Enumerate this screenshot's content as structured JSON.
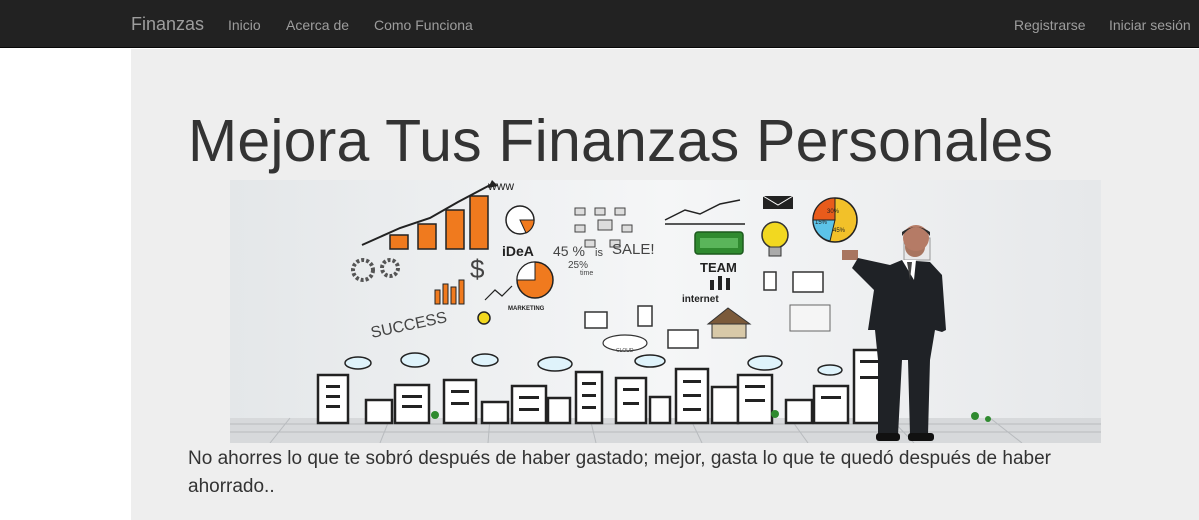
{
  "navbar": {
    "brand": "Finanzas",
    "links": [
      "Inicio",
      "Acerca de",
      "Como Funciona"
    ],
    "right_links": [
      "Registrarse",
      "Iniciar sesión"
    ],
    "background": "#222222",
    "link_color": "#9d9d9d"
  },
  "hero": {
    "title": "Mejora Tus Finanzas Personales",
    "tagline": "No ahorres lo que te sobró después de haber gastado; mejor, gasta lo que te quedó después de haber ahorrado..",
    "background": "#eeeeee",
    "image_text": {
      "www": "www",
      "idea": "iDeA",
      "percent": "45 %",
      "is": "is",
      "sale": "SALE!",
      "pct25": "25%",
      "time": "time",
      "team": "TEAM",
      "internet": "internet",
      "marketing": "MARKETING",
      "success": "SUCCESS",
      "cloud": "CLOUD",
      "pie_a": "30%",
      "pie_b": "15%",
      "pie_c": "45%"
    }
  }
}
